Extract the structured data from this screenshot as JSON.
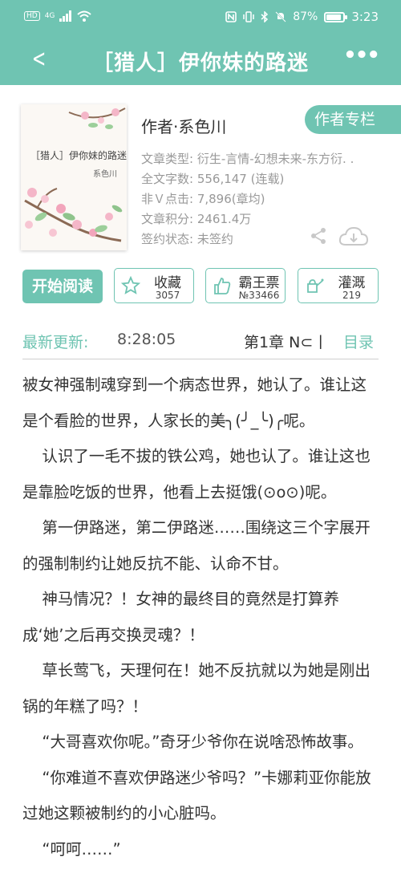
{
  "status_bar": {
    "left_icons": [
      "HD",
      "4G",
      "signal-icon",
      "wifi-icon"
    ],
    "right_icons": [
      "nfc-icon",
      "vibrate-icon",
      "bluetooth-icon",
      "mute-icon"
    ],
    "battery_text": "87%",
    "battery_level": 0.87,
    "time": "3:23"
  },
  "app_bar": {
    "title": "［猎人］伊你妹的路迷"
  },
  "book": {
    "cover_title": "［猎人］伊你妹的路迷",
    "cover_author": "系色川",
    "author_line": "作者·系色川",
    "author_tag": "作者专栏",
    "meta": [
      "文章类型: 衍生-言情-幻想未来-东方衍. .",
      "全文字数: 556,147 (连载)",
      "非Ｖ点击: 7,896(章均)",
      "文章积分: 2461.4万",
      "签约状态: 未签约"
    ]
  },
  "actions": {
    "read": "开始阅读",
    "favorite": {
      "label": "收藏",
      "count": "3057"
    },
    "ticket": {
      "label": "霸王票",
      "count": "№33466"
    },
    "water": {
      "label": "灌溉",
      "count": "219"
    }
  },
  "update": {
    "label": "最新更新:",
    "time": "8:28:05",
    "chapter": "第1章  N⊂丨",
    "toc": "目录"
  },
  "content": [
    "被女神强制魂穿到一个病态世界，她认了。谁让这是个看脸的世界，人家长的美╮(╯_╰)╭呢。",
    "认识了一毛不拔的铁公鸡，她也认了。谁让这也是靠脸吃饭的世界，他看上去挺饿(⊙o⊙)呢。",
    "第一伊路迷，第二伊路迷……围绕这三个字展开的强制制约让她反抗不能、认命不甘。",
    "神马情况？！女神的最终目的竟然是打算养成‘她’之后再交换灵魂？！",
    "草长莺飞，天理何在！她不反抗就以为她是刚出锅的年糕了吗？！",
    "“大哥喜欢你呢。”奇牙少爷你在说啥恐怖故事。",
    "“你难道不喜欢伊路迷少爷吗？”卡娜莉亚你能放过她这颗被制约的小心脏吗。",
    "“呵呵……”"
  ]
}
